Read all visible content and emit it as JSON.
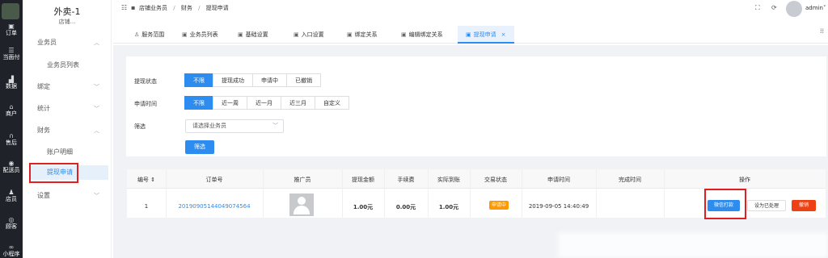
{
  "rail": {
    "items": [
      {
        "icon": "list-icon",
        "label": "订单"
      },
      {
        "icon": "list-icon",
        "label": "当面付"
      },
      {
        "icon": "bar-chart-icon",
        "label": "数据"
      },
      {
        "icon": "shop-icon",
        "label": "商户"
      },
      {
        "icon": "headset-icon",
        "label": "售后"
      },
      {
        "icon": "rider-icon",
        "label": "配送员"
      },
      {
        "icon": "user-icon",
        "label": "店员"
      },
      {
        "icon": "customer-icon",
        "label": "顾客"
      },
      {
        "icon": "miniapp-icon",
        "label": "小程序"
      }
    ]
  },
  "sidebar": {
    "store_title": "外卖-1",
    "store_sub": "店铺...",
    "items": [
      {
        "label": "业务员"
      },
      {
        "label": "业务员列表"
      },
      {
        "label": "绑定"
      },
      {
        "label": "统计"
      },
      {
        "label": "财务"
      },
      {
        "label": "账户明细"
      },
      {
        "label": "提现申请"
      },
      {
        "label": "设置"
      }
    ]
  },
  "header": {
    "breadcrumb": [
      "店铺业务员",
      "财务",
      "提现申请"
    ],
    "separator": "/",
    "user": "admin"
  },
  "tabs": [
    {
      "label": "服务范围"
    },
    {
      "label": "业务员列表"
    },
    {
      "label": "基础设置"
    },
    {
      "label": "入口设置"
    },
    {
      "label": "绑定关系"
    },
    {
      "label": "编辑绑定关系"
    },
    {
      "label": "提现申请"
    }
  ],
  "filters": {
    "status_label": "提现状态",
    "status_options": [
      "不限",
      "提现成功",
      "申请中",
      "已撤销"
    ],
    "time_label": "申请时间",
    "time_options": [
      "不限",
      "近一周",
      "近一月",
      "近三月",
      "自定义"
    ],
    "screen_label": "筛选",
    "select_placeholder": "请选择业务员",
    "filter_button": "筛选"
  },
  "table": {
    "headers": [
      "编号",
      "订单号",
      "推广员",
      "提现金额",
      "手续费",
      "实际到账",
      "交易状态",
      "申请时间",
      "完成时间",
      "操作"
    ],
    "rows": [
      {
        "id": "1",
        "order_no": "20190905144049074564",
        "amount": "1.00元",
        "fee": "0.00元",
        "received": "1.00元",
        "status": "申请中",
        "apply_time": "2019-09-05 14:40:49",
        "finish_time": "",
        "actions": [
          "微信打款",
          "设为已处理",
          "撤销"
        ]
      }
    ]
  },
  "colors": {
    "primary": "#2d8cf0",
    "warning": "#ff9900",
    "danger": "#ed4014",
    "highlight": "#e02020",
    "rail_bg": "#1f2329"
  }
}
